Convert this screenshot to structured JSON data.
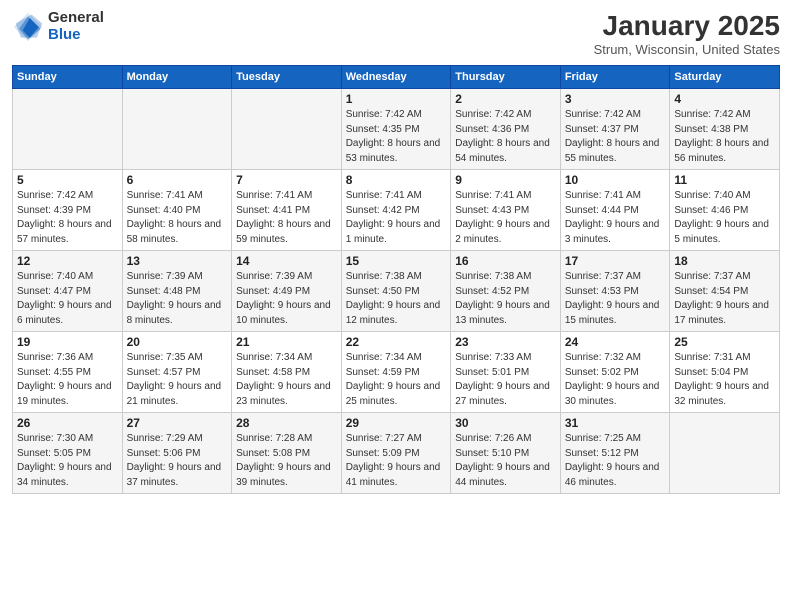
{
  "header": {
    "logo_general": "General",
    "logo_blue": "Blue",
    "month_title": "January 2025",
    "location": "Strum, Wisconsin, United States"
  },
  "days_of_week": [
    "Sunday",
    "Monday",
    "Tuesday",
    "Wednesday",
    "Thursday",
    "Friday",
    "Saturday"
  ],
  "weeks": [
    {
      "days": [
        {
          "num": "",
          "info": ""
        },
        {
          "num": "",
          "info": ""
        },
        {
          "num": "",
          "info": ""
        },
        {
          "num": "1",
          "info": "Sunrise: 7:42 AM\nSunset: 4:35 PM\nDaylight: 8 hours and 53 minutes."
        },
        {
          "num": "2",
          "info": "Sunrise: 7:42 AM\nSunset: 4:36 PM\nDaylight: 8 hours and 54 minutes."
        },
        {
          "num": "3",
          "info": "Sunrise: 7:42 AM\nSunset: 4:37 PM\nDaylight: 8 hours and 55 minutes."
        },
        {
          "num": "4",
          "info": "Sunrise: 7:42 AM\nSunset: 4:38 PM\nDaylight: 8 hours and 56 minutes."
        }
      ]
    },
    {
      "days": [
        {
          "num": "5",
          "info": "Sunrise: 7:42 AM\nSunset: 4:39 PM\nDaylight: 8 hours and 57 minutes."
        },
        {
          "num": "6",
          "info": "Sunrise: 7:41 AM\nSunset: 4:40 PM\nDaylight: 8 hours and 58 minutes."
        },
        {
          "num": "7",
          "info": "Sunrise: 7:41 AM\nSunset: 4:41 PM\nDaylight: 8 hours and 59 minutes."
        },
        {
          "num": "8",
          "info": "Sunrise: 7:41 AM\nSunset: 4:42 PM\nDaylight: 9 hours and 1 minute."
        },
        {
          "num": "9",
          "info": "Sunrise: 7:41 AM\nSunset: 4:43 PM\nDaylight: 9 hours and 2 minutes."
        },
        {
          "num": "10",
          "info": "Sunrise: 7:41 AM\nSunset: 4:44 PM\nDaylight: 9 hours and 3 minutes."
        },
        {
          "num": "11",
          "info": "Sunrise: 7:40 AM\nSunset: 4:46 PM\nDaylight: 9 hours and 5 minutes."
        }
      ]
    },
    {
      "days": [
        {
          "num": "12",
          "info": "Sunrise: 7:40 AM\nSunset: 4:47 PM\nDaylight: 9 hours and 6 minutes."
        },
        {
          "num": "13",
          "info": "Sunrise: 7:39 AM\nSunset: 4:48 PM\nDaylight: 9 hours and 8 minutes."
        },
        {
          "num": "14",
          "info": "Sunrise: 7:39 AM\nSunset: 4:49 PM\nDaylight: 9 hours and 10 minutes."
        },
        {
          "num": "15",
          "info": "Sunrise: 7:38 AM\nSunset: 4:50 PM\nDaylight: 9 hours and 12 minutes."
        },
        {
          "num": "16",
          "info": "Sunrise: 7:38 AM\nSunset: 4:52 PM\nDaylight: 9 hours and 13 minutes."
        },
        {
          "num": "17",
          "info": "Sunrise: 7:37 AM\nSunset: 4:53 PM\nDaylight: 9 hours and 15 minutes."
        },
        {
          "num": "18",
          "info": "Sunrise: 7:37 AM\nSunset: 4:54 PM\nDaylight: 9 hours and 17 minutes."
        }
      ]
    },
    {
      "days": [
        {
          "num": "19",
          "info": "Sunrise: 7:36 AM\nSunset: 4:55 PM\nDaylight: 9 hours and 19 minutes."
        },
        {
          "num": "20",
          "info": "Sunrise: 7:35 AM\nSunset: 4:57 PM\nDaylight: 9 hours and 21 minutes."
        },
        {
          "num": "21",
          "info": "Sunrise: 7:34 AM\nSunset: 4:58 PM\nDaylight: 9 hours and 23 minutes."
        },
        {
          "num": "22",
          "info": "Sunrise: 7:34 AM\nSunset: 4:59 PM\nDaylight: 9 hours and 25 minutes."
        },
        {
          "num": "23",
          "info": "Sunrise: 7:33 AM\nSunset: 5:01 PM\nDaylight: 9 hours and 27 minutes."
        },
        {
          "num": "24",
          "info": "Sunrise: 7:32 AM\nSunset: 5:02 PM\nDaylight: 9 hours and 30 minutes."
        },
        {
          "num": "25",
          "info": "Sunrise: 7:31 AM\nSunset: 5:04 PM\nDaylight: 9 hours and 32 minutes."
        }
      ]
    },
    {
      "days": [
        {
          "num": "26",
          "info": "Sunrise: 7:30 AM\nSunset: 5:05 PM\nDaylight: 9 hours and 34 minutes."
        },
        {
          "num": "27",
          "info": "Sunrise: 7:29 AM\nSunset: 5:06 PM\nDaylight: 9 hours and 37 minutes."
        },
        {
          "num": "28",
          "info": "Sunrise: 7:28 AM\nSunset: 5:08 PM\nDaylight: 9 hours and 39 minutes."
        },
        {
          "num": "29",
          "info": "Sunrise: 7:27 AM\nSunset: 5:09 PM\nDaylight: 9 hours and 41 minutes."
        },
        {
          "num": "30",
          "info": "Sunrise: 7:26 AM\nSunset: 5:10 PM\nDaylight: 9 hours and 44 minutes."
        },
        {
          "num": "31",
          "info": "Sunrise: 7:25 AM\nSunset: 5:12 PM\nDaylight: 9 hours and 46 minutes."
        },
        {
          "num": "",
          "info": ""
        }
      ]
    }
  ]
}
